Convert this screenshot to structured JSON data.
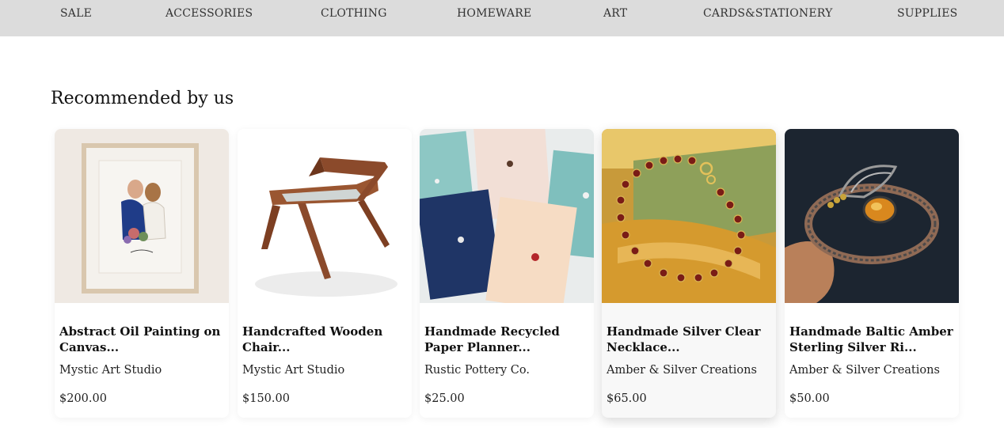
{
  "nav": {
    "items": [
      "SALE",
      "ACCESSORIES",
      "CLOTHING",
      "HOMEWARE",
      "ART",
      "CARDS&STATIONERY",
      "SUPPLIES"
    ]
  },
  "section": {
    "title": "Recommended by us"
  },
  "products": [
    {
      "title": "Abstract Oil Painting on Canvas...",
      "seller": "Mystic Art Studio",
      "price": "$200.00",
      "image": "framed-wedding-portrait-image"
    },
    {
      "title": "Handcrafted Wooden Chair...",
      "seller": "Mystic Art Studio",
      "price": "$150.00",
      "image": "wooden-chair-image"
    },
    {
      "title": "Handmade Recycled Paper Planner...",
      "seller": "Rustic Pottery Co.",
      "price": "$25.00",
      "image": "paper-planners-image"
    },
    {
      "title": "Handmade Silver Clear Necklace...",
      "seller": "Amber & Silver Creations",
      "price": "$65.00",
      "image": "garnet-bracelet-image"
    },
    {
      "title": "Handmade Baltic Amber Sterling Silver Ri...",
      "seller": "Amber & Silver Creations",
      "price": "$50.00",
      "image": "amber-bracelet-image"
    }
  ],
  "colors": {
    "nav_bg": "#dcdcdc",
    "page_bg": "#ffffff",
    "text": "#111111"
  }
}
